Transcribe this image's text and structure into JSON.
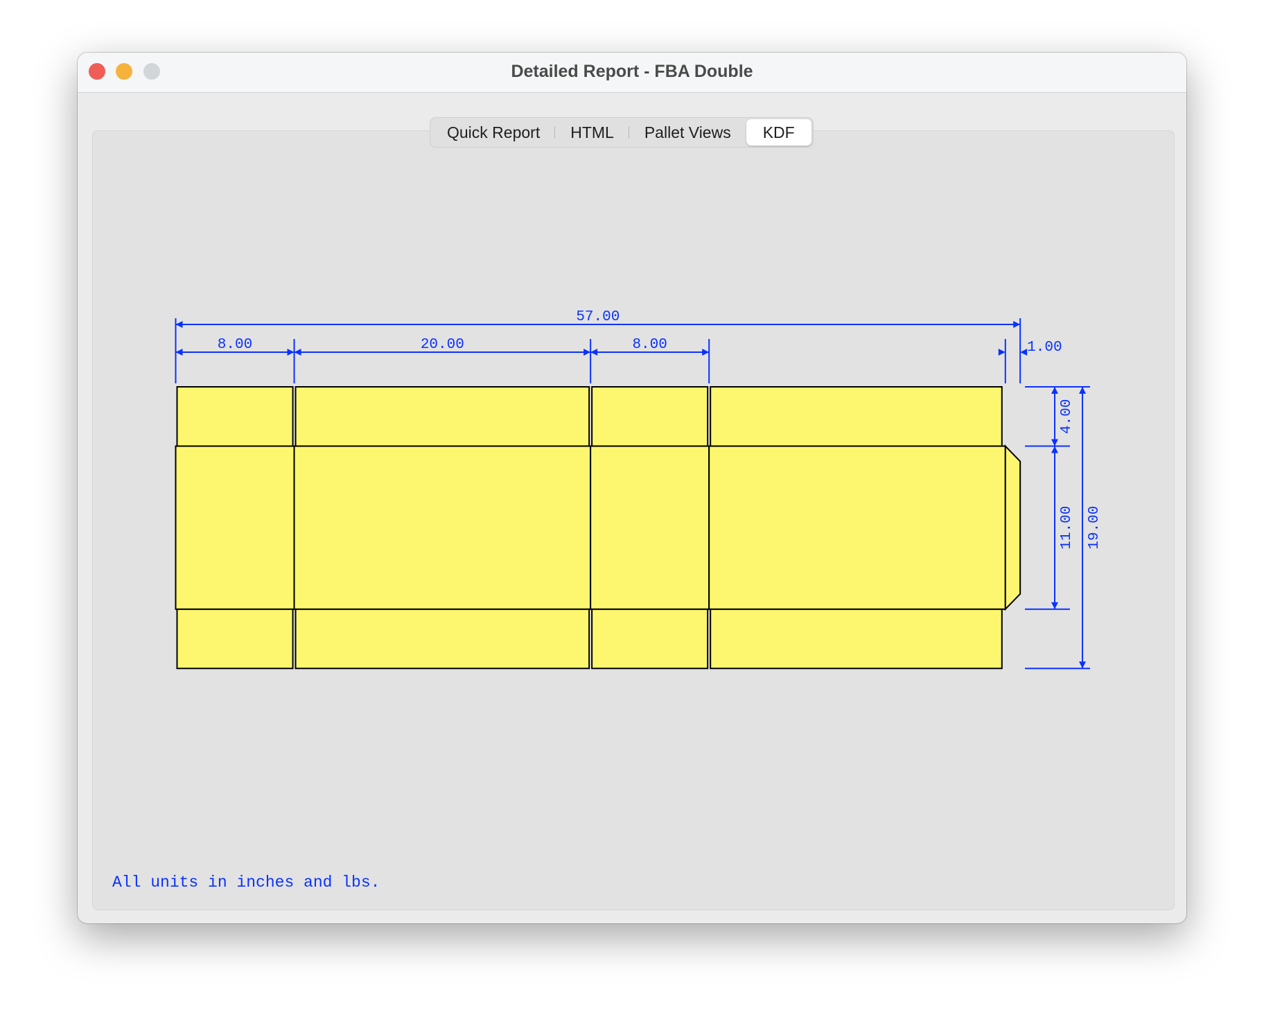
{
  "window": {
    "title": "Detailed Report - FBA Double",
    "controls": [
      "close",
      "minimize",
      "zoom"
    ],
    "control_colors": {
      "close": "#ee5e57",
      "minimize": "#f5b33d",
      "zoom": "#d3d6d8"
    }
  },
  "tabs": [
    {
      "label": "Quick Report",
      "active": false
    },
    {
      "label": "HTML",
      "active": false
    },
    {
      "label": "Pallet Views",
      "active": false
    },
    {
      "label": "KDF",
      "active": true
    }
  ],
  "kdf": {
    "fill_color": "#fdf76f",
    "dimension_color": "#0a32ff",
    "panels": [
      8,
      20,
      8,
      20
    ],
    "glue_flap": 1,
    "top_flap": 4,
    "body_height": 11,
    "bottom_flap": 4,
    "dimensions": {
      "overall_width": "57.00",
      "panel_widths": [
        "8.00",
        "20.00",
        "8.00"
      ],
      "glue_flap": "1.00",
      "flap_height": "4.00",
      "body_height": "11.00",
      "overall_height": "19.00"
    }
  },
  "footer": {
    "units_note": "All units in inches and lbs."
  }
}
